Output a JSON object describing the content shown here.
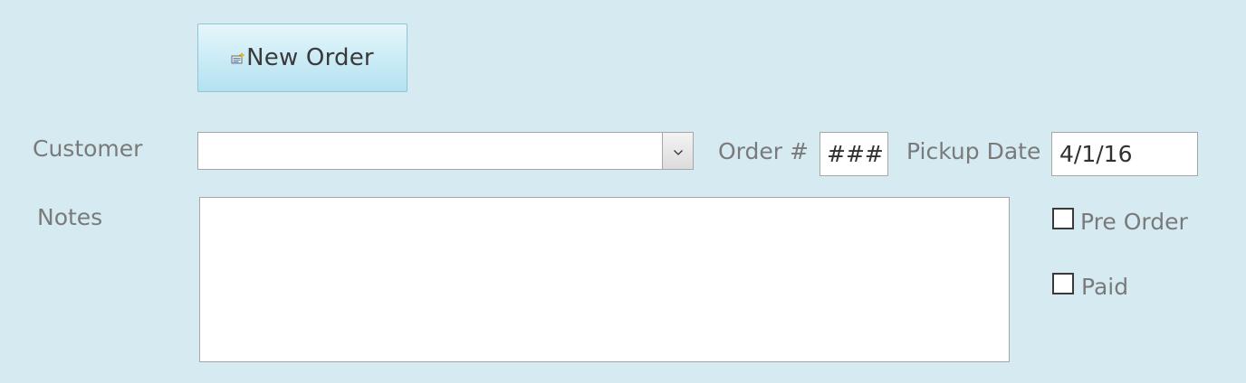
{
  "toolbar": {
    "new_order_label": "New Order",
    "new_order_icon": "new-record-icon"
  },
  "form": {
    "customer_label": "Customer",
    "customer_value": "",
    "order_number_label": "Order #",
    "order_number_value": "####",
    "pickup_date_label": "Pickup Date",
    "pickup_date_value": "4/1/16",
    "notes_label": "Notes",
    "notes_value": "",
    "pre_order_label": "Pre Order",
    "pre_order_checked": false,
    "paid_label": "Paid",
    "paid_checked": false
  },
  "colors": {
    "background": "#d5ebf1",
    "label_text": "#7a7a7a",
    "button_gradient_top": "#e6f6fb",
    "button_gradient_bottom": "#b4e1f0"
  }
}
